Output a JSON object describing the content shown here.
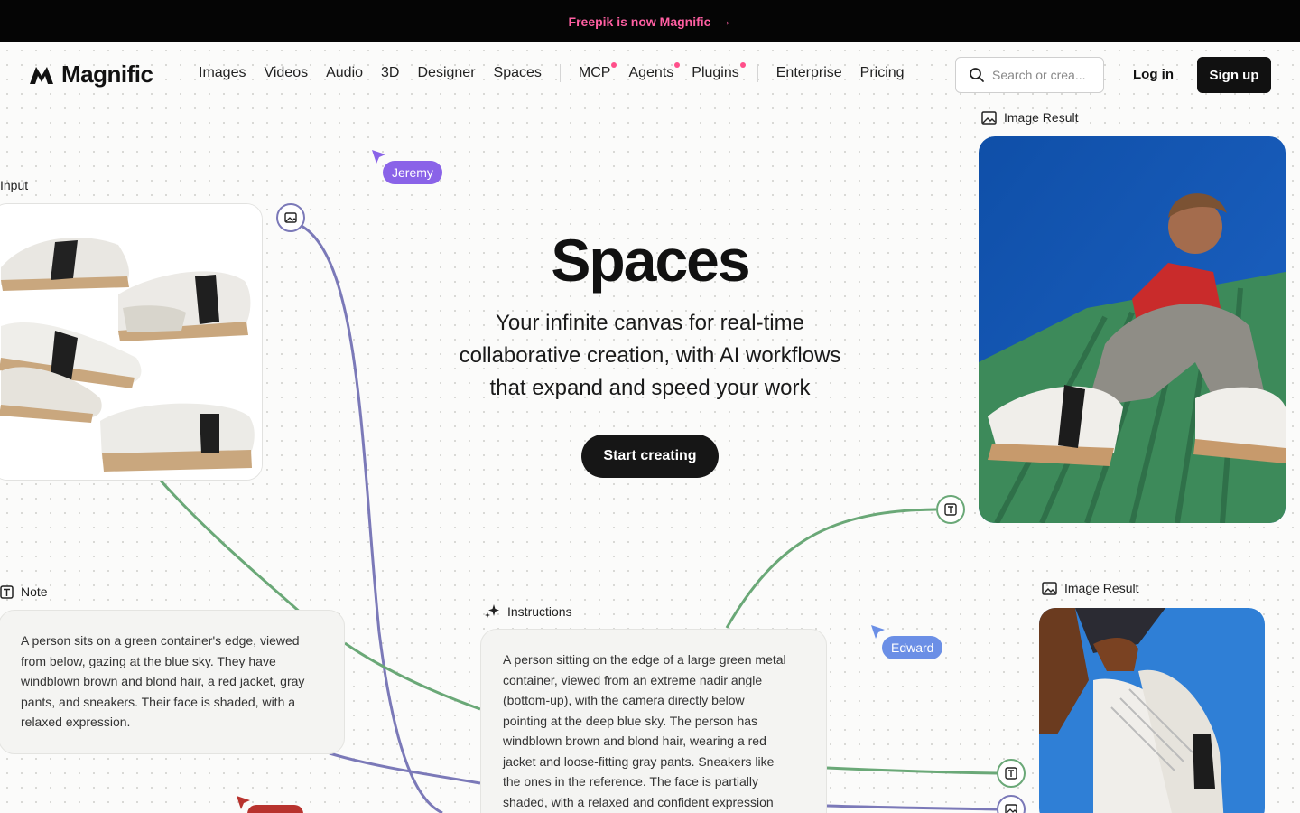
{
  "banner": {
    "text": "Freepik is now Magnific",
    "arrow": "→"
  },
  "brand": {
    "name": "Magnific",
    "logo_icon": "magnific-logo-icon",
    "accent": "#ff5fa2"
  },
  "nav": {
    "items": [
      "Images",
      "Videos",
      "Audio",
      "3D",
      "Designer",
      "Spaces",
      "MCP",
      "Agents",
      "Plugins",
      "Enterprise",
      "Pricing"
    ],
    "new_dot_items": [
      "MCP",
      "Agents",
      "Plugins"
    ]
  },
  "search": {
    "placeholder": "Search or crea...",
    "icon": "search-icon"
  },
  "auth": {
    "login": "Log in",
    "signup": "Sign up"
  },
  "hero": {
    "title": "Spaces",
    "subtitle_lines": [
      "Your infinite canvas for real-time",
      "collaborative creation, with AI workflows",
      "that expand and speed your work"
    ],
    "cta": "Start creating"
  },
  "nodes": {
    "input": {
      "label": "Input",
      "icon": "image-icon"
    },
    "image_result_1": {
      "label": "Image Result",
      "icon": "image-icon"
    },
    "image_result_2": {
      "label": "Image Result",
      "icon": "image-icon"
    },
    "note": {
      "label": "Note",
      "icon": "text-icon",
      "lines": [
        "A person sits on a green container's edge, viewed",
        "from below, gazing at the blue sky. They have",
        "windblown brown and blond hair, a red jacket, gray",
        "pants, and sneakers. Their face is shaded, with a",
        "relaxed expression."
      ]
    },
    "instructions": {
      "label": "Instructions",
      "icon": "sparkles-icon",
      "lines": [
        "A person sitting on the edge of a large green metal",
        "container, viewed from an extreme nadir angle",
        "(bottom-up), with the camera directly below",
        "pointing at the deep blue sky. The person has",
        "windblown brown and blond hair, wearing a red",
        "jacket and loose-fitting gray pants. Sneakers like",
        "the ones in the reference. The face is partially",
        "shaded, with a relaxed and confident expression"
      ]
    }
  },
  "collaborators": [
    {
      "name": "Jeremy",
      "color": "#8a63e8"
    },
    {
      "name": "Edward",
      "color": "#6b8fe6"
    }
  ],
  "colors": {
    "wire_purple": "#7b79b8",
    "wire_green": "#6aa877",
    "red_cursor": "#b8332e"
  }
}
